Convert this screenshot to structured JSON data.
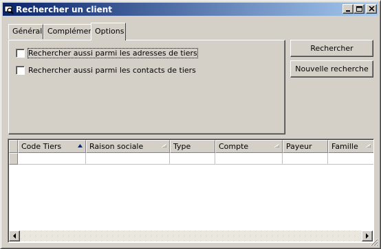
{
  "window": {
    "title": "Rechercher un client",
    "icon": "search-client-app-icon"
  },
  "tabs": [
    {
      "label": "Général",
      "active": false
    },
    {
      "label": "Complément",
      "active": false
    },
    {
      "label": "Options",
      "active": true
    }
  ],
  "options": [
    {
      "label": "Rechercher aussi parmi les adresses de tiers",
      "checked": false
    },
    {
      "label": "Rechercher aussi parmi les contacts de tiers",
      "checked": false
    }
  ],
  "buttons": {
    "search": "Rechercher",
    "new_search": "Nouvelle recherche"
  },
  "grid": {
    "columns": [
      {
        "label": "Code Tiers",
        "sort": "ascending"
      },
      {
        "label": "Raison sociale",
        "sort": "none"
      },
      {
        "label": "Type",
        "sort": null
      },
      {
        "label": "Compte",
        "sort": "none"
      },
      {
        "label": "Payeur",
        "sort": null
      },
      {
        "label": "Famille",
        "sort": "none"
      }
    ],
    "rows": [
      [
        "",
        "",
        "",
        "",
        "",
        ""
      ]
    ]
  }
}
